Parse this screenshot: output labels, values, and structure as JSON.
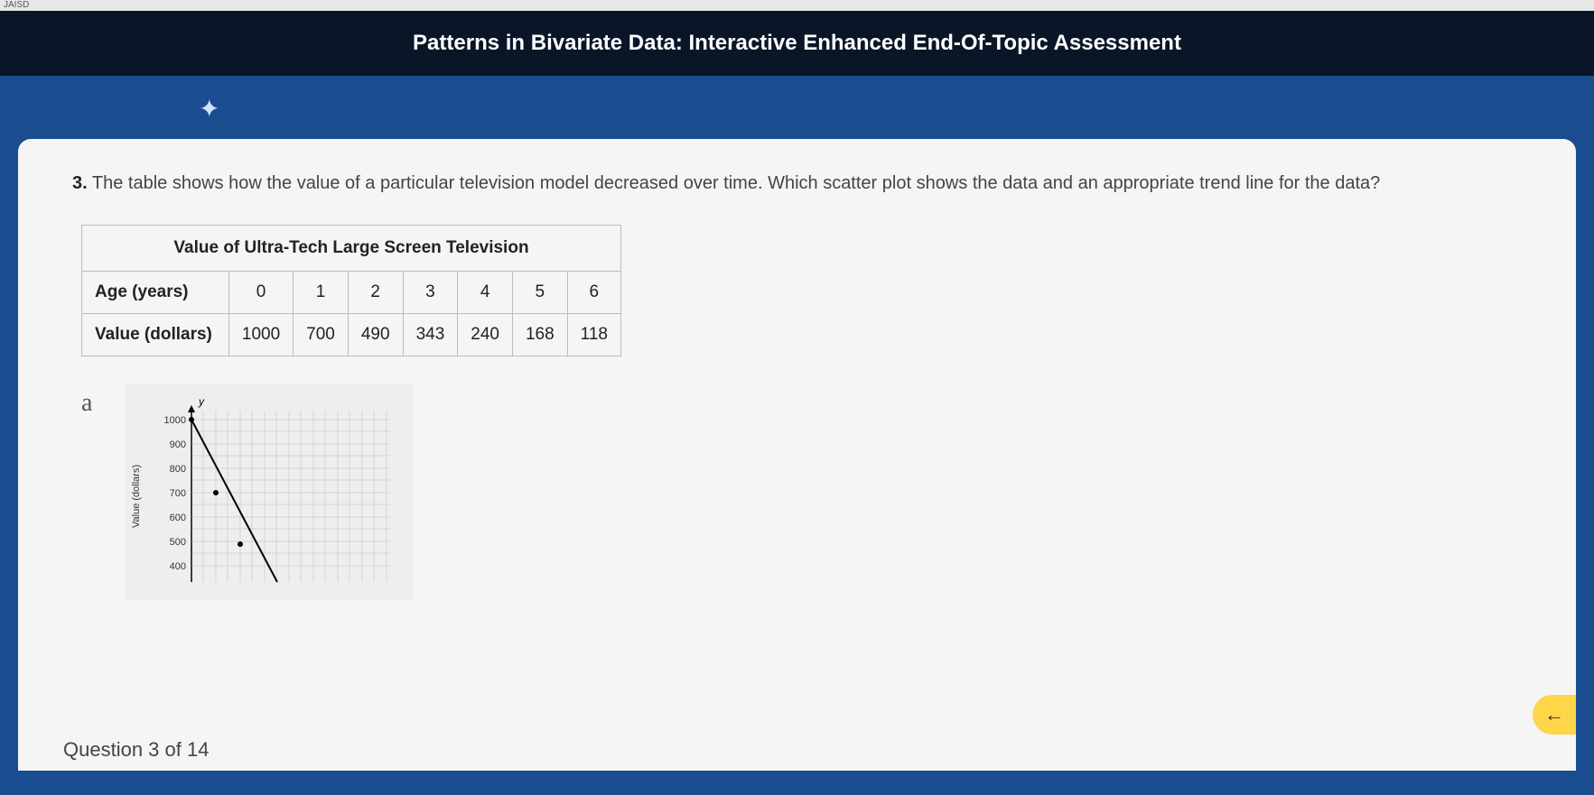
{
  "top_strip": "JAISD",
  "title": "Patterns in Bivariate Data: Interactive Enhanced End-Of-Topic Assessment",
  "question": {
    "number": "3.",
    "text": "The table shows how the value of a particular television model decreased over time. Which scatter plot shows the data and an appropriate trend line for the data?"
  },
  "table": {
    "caption": "Value of Ultra-Tech Large Screen Television",
    "row1_label": "Age (years)",
    "row1": [
      "0",
      "1",
      "2",
      "3",
      "4",
      "5",
      "6"
    ],
    "row2_label": "Value (dollars)",
    "row2": [
      "1000",
      "700",
      "490",
      "343",
      "240",
      "168",
      "118"
    ]
  },
  "option_letter": "a",
  "chart_data": {
    "type": "scatter",
    "title": "",
    "xlabel": "",
    "ylabel": "Value (dollars)",
    "y_axis_title_char": "y",
    "ylim": [
      400,
      1000
    ],
    "yticks": [
      400,
      500,
      600,
      700,
      800,
      900,
      1000
    ],
    "points": [
      {
        "x": 0,
        "y": 1000
      },
      {
        "x": 1,
        "y": 700
      },
      {
        "x": 2,
        "y": 490
      }
    ],
    "trend_line": {
      "x1": 0,
      "y1": 1000,
      "x2": 3.5,
      "y2": 400
    }
  },
  "counter": "Question 3 of 14",
  "nav_arrow": "←"
}
